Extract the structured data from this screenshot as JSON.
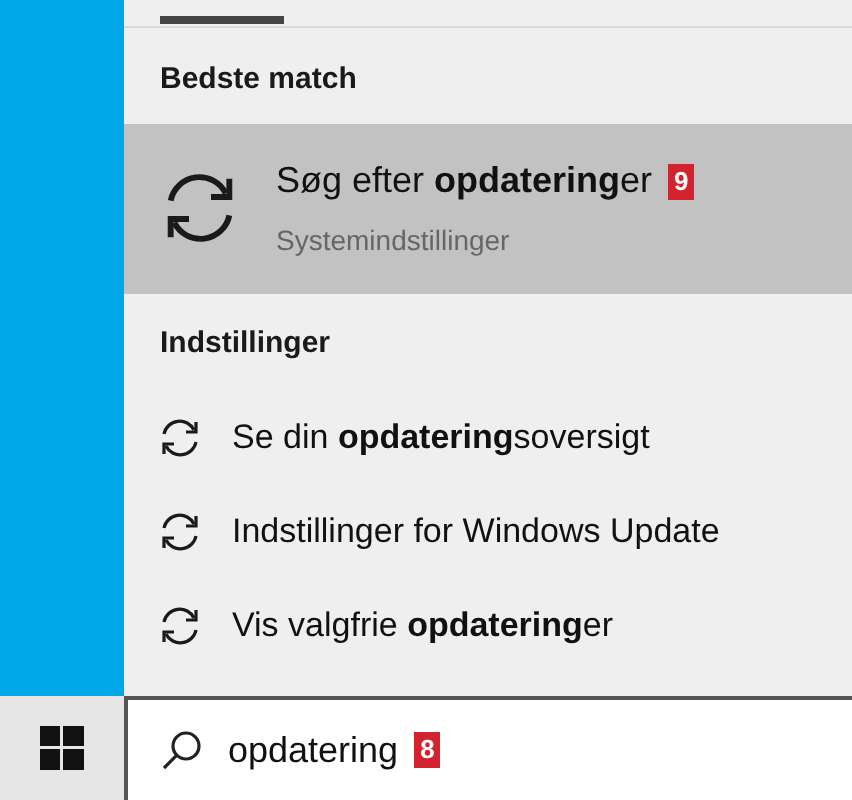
{
  "best_match": {
    "header": "Bedste match",
    "item": {
      "title": "Søg efter **opdatering**er",
      "subtitle": "Systemindstillinger",
      "badge": "9",
      "selected": true
    }
  },
  "settings": {
    "header": "Indstillinger",
    "items": [
      {
        "title": "Se din **opdatering**soversigt",
        "selected": false
      },
      {
        "title": "Indstillinger for Windows Update",
        "selected": false
      },
      {
        "title": "Vis valgfrie **opdatering**er",
        "selected": false
      }
    ]
  },
  "search": {
    "value": "opdatering",
    "badge": "8"
  }
}
